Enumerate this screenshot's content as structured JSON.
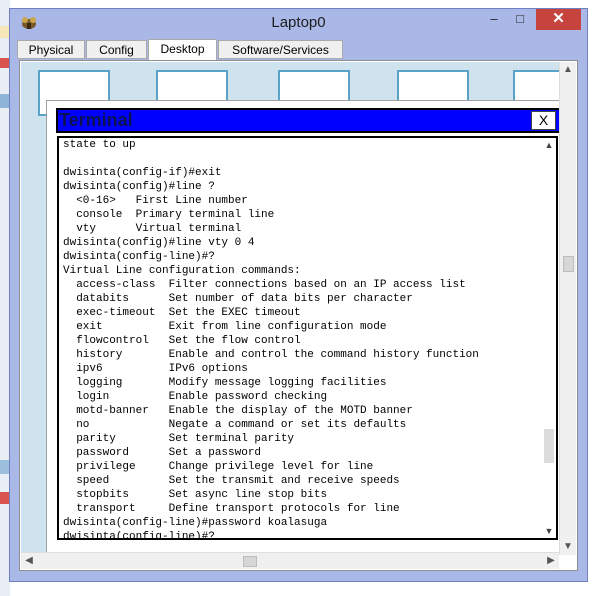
{
  "window": {
    "title": "Laptop0",
    "controls": {
      "minimize": "–",
      "maximize": "□",
      "close": "✕"
    },
    "app_icon": "packet-tracer-device-icon"
  },
  "tabs": [
    {
      "label": "Physical",
      "active": false
    },
    {
      "label": "Config",
      "active": false
    },
    {
      "label": "Desktop",
      "active": true
    },
    {
      "label": "Software/Services",
      "active": false
    }
  ],
  "terminal": {
    "title": "Terminal",
    "close_label": "X",
    "lines": [
      "state to up",
      "",
      "dwisinta(config-if)#exit",
      "dwisinta(config)#line ?",
      "  <0-16>   First Line number",
      "  console  Primary terminal line",
      "  vty      Virtual terminal",
      "dwisinta(config)#line vty 0 4",
      "dwisinta(config-line)#?",
      "Virtual Line configuration commands:",
      "  access-class  Filter connections based on an IP access list",
      "  databits      Set number of data bits per character",
      "  exec-timeout  Set the EXEC timeout",
      "  exit          Exit from line configuration mode",
      "  flowcontrol   Set the flow control",
      "  history       Enable and control the command history function",
      "  ipv6          IPv6 options",
      "  logging       Modify message logging facilities",
      "  login         Enable password checking",
      "  motd-banner   Enable the display of the MOTD banner",
      "  no            Negate a command or set its defaults",
      "  parity        Set terminal parity",
      "  password      Set a password",
      "  privilege     Change privilege level for line",
      "  speed         Set the transmit and receive speeds",
      "  stopbits      Set async line stop bits",
      "  transport     Define transport protocols for line",
      "dwisinta(config-line)#password koalasuga",
      "dwisinta(config-line)#?"
    ]
  },
  "colors": {
    "window_frame": "#a9b8e6",
    "close_button": "#c7433d",
    "terminal_bar": "#0000ff",
    "desktop_bg": "#cfe3ef"
  }
}
